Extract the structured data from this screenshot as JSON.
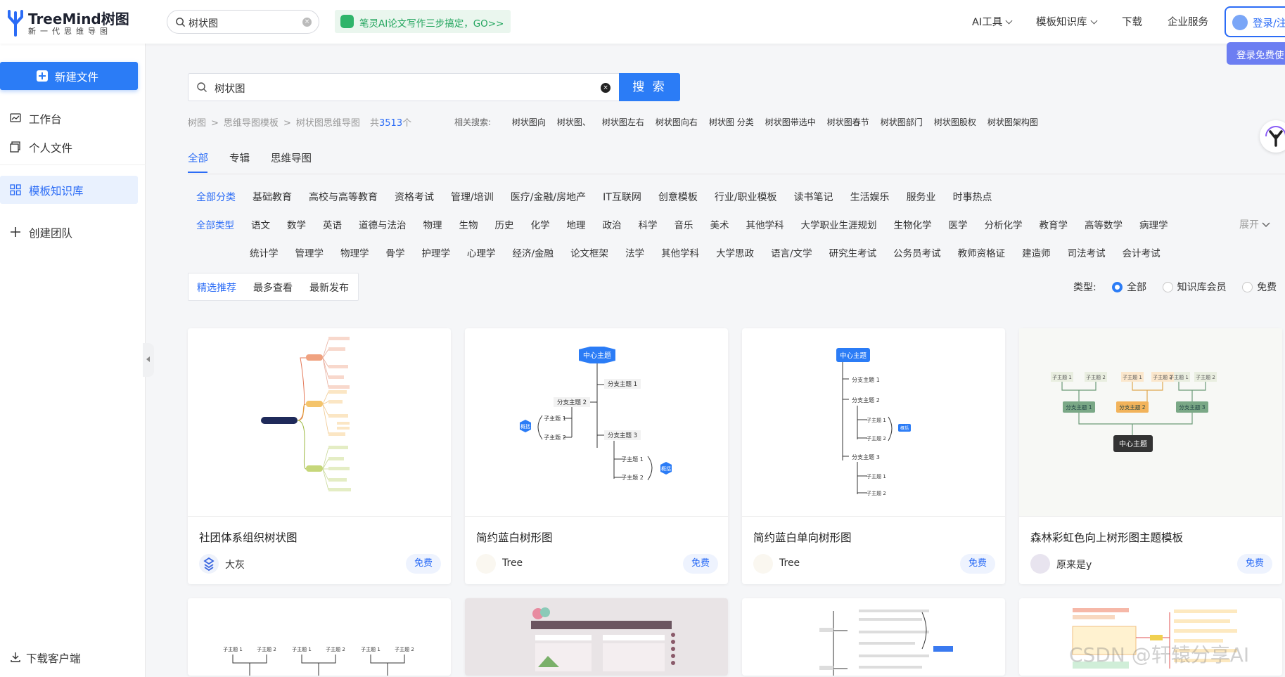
{
  "header": {
    "logo_title": "TreeMind树图",
    "logo_subtitle": "新一代思维导图",
    "search_value": "树状图",
    "promo_text": "笔灵AI论文写作三步搞定，GO>>",
    "nav": [
      {
        "label": "AI工具"
      },
      {
        "label": "模板知识库"
      },
      {
        "label": "下载"
      },
      {
        "label": "企业服务"
      }
    ],
    "login_label": "登录/注",
    "login_tip": "登录免费使"
  },
  "sidebar": {
    "new_file": "新建文件",
    "items": [
      {
        "label": "工作台",
        "icon": "chart-icon"
      },
      {
        "label": "个人文件",
        "icon": "folder-icon"
      },
      {
        "label": "模板知识库",
        "icon": "grid-icon"
      },
      {
        "label": "创建团队",
        "icon": "plus-icon"
      }
    ],
    "download_client": "下载客户端"
  },
  "main": {
    "search_value": "树状图",
    "search_button": "搜 索",
    "breadcrumb": [
      "树图",
      "思维导图模板",
      "树状图思维导图"
    ],
    "result_prefix": "共",
    "result_count": "3513",
    "result_suffix": "个",
    "related_label": "相关搜索:",
    "related": [
      "树状图向",
      "树状图、",
      "树状图左右",
      "树状图向右",
      "树状图 分类",
      "树状图带选中",
      "树状图春节",
      "树状图部门",
      "树状图股权",
      "树状图架构图"
    ],
    "tabs": [
      "全部",
      "专辑",
      "思维导图"
    ],
    "categories": [
      "全部分类",
      "基础教育",
      "高校与高等教育",
      "资格考试",
      "管理/培训",
      "医疗/金融/房地产",
      "IT互联网",
      "创意模板",
      "行业/职业模板",
      "读书笔记",
      "生活娱乐",
      "服务业",
      "时事热点"
    ],
    "types_row1": [
      "全部类型",
      "语文",
      "数学",
      "英语",
      "道德与法治",
      "物理",
      "生物",
      "历史",
      "化学",
      "地理",
      "政治",
      "科学",
      "音乐",
      "美术",
      "其他学科",
      "大学职业生涯规划",
      "生物化学",
      "医学",
      "分析化学",
      "教育学",
      "高等数学",
      "病理学"
    ],
    "types_row2": [
      "统计学",
      "管理学",
      "物理学",
      "骨学",
      "护理学",
      "心理学",
      "经济/金融",
      "论文框架",
      "法学",
      "其他学科",
      "大学思政",
      "语言/文学",
      "研究生考试",
      "公务员考试",
      "教师资格证",
      "建造师",
      "司法考试",
      "会计考试"
    ],
    "expand_label": "展开",
    "sort": [
      "精选推荐",
      "最多查看",
      "最新发布"
    ],
    "type_filter": {
      "label": "类型:",
      "options": [
        "全部",
        "知识库会员",
        "免费"
      ]
    },
    "cards": [
      {
        "title": "社团体系组织树状图",
        "author": "大灰",
        "badge": "免费"
      },
      {
        "title": "简约蓝白树形图",
        "author": "Tree",
        "badge": "免费"
      },
      {
        "title": "简约蓝白单向树形图",
        "author": "Tree",
        "badge": "免费"
      },
      {
        "title": "森林彩虹色向上树形图主题模板",
        "author": "原来是y",
        "badge": "免费"
      }
    ]
  },
  "thumbs": {
    "t2": {
      "center": "中心主题",
      "b1": "分支主题 1",
      "b2": "分支主题 2",
      "b3": "分支主题 3",
      "s1": "子主题 1",
      "s2": "子主题 2",
      "sum": "概括"
    },
    "t3": {
      "center": "中心主题",
      "b1": "分支主题 1",
      "b2": "分支主题 2",
      "b3": "分支主题 3",
      "s1": "子主题 1",
      "s2": "子主题 2",
      "sum": "概括"
    },
    "t4": {
      "center": "中心主题",
      "b1": "分支主题 1",
      "b2": "分支主题 2",
      "b3": "分支主题 3",
      "s1": "子主题 1",
      "s2": "子主题 2"
    },
    "r2a": {
      "s1": "子主题 1",
      "s2": "子主题 2"
    }
  },
  "watermark": "CSDN @轩辕分享AI",
  "colors": {
    "accent": "#2b7cf6",
    "promo": "#20a45c"
  }
}
